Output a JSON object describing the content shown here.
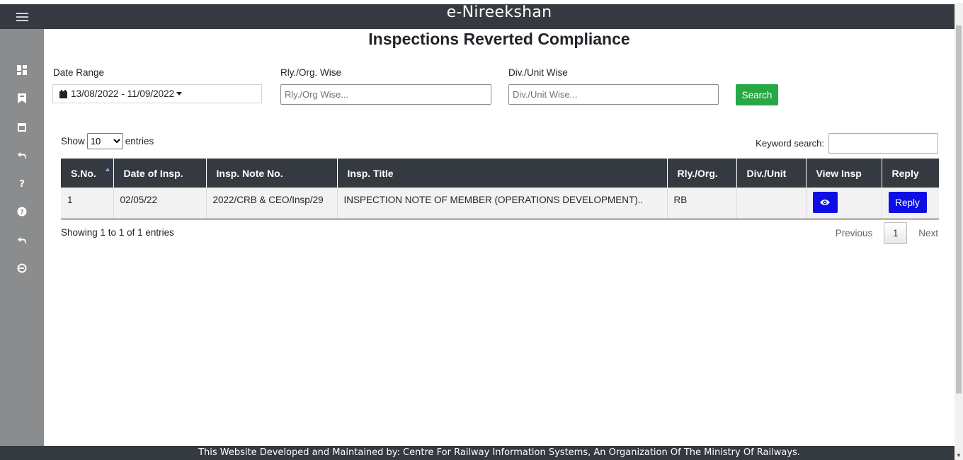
{
  "header": {
    "brand": "e-Nireekshan"
  },
  "sidebar": {
    "items": [
      {
        "icon": "dashboard-icon"
      },
      {
        "icon": "bookmark-icon"
      },
      {
        "icon": "calendar-icon"
      },
      {
        "icon": "reply-icon"
      },
      {
        "icon": "question-icon"
      },
      {
        "icon": "help-circle-icon"
      },
      {
        "icon": "reply-icon"
      },
      {
        "icon": "logout-icon"
      }
    ]
  },
  "page": {
    "title": "Inspections Reverted Compliance"
  },
  "filters": {
    "date_range_label": "Date Range",
    "date_range_value": "13/08/2022 - 11/09/2022",
    "rly_label": "Rly./Org. Wise",
    "rly_placeholder": "Rly./Org Wise...",
    "div_label": "Div./Unit Wise",
    "div_placeholder": "Div./Unit Wise...",
    "search_label": "Search"
  },
  "table_controls": {
    "show_label": "Show",
    "entries_value": "10",
    "entries_label": "entries",
    "keyword_label": "Keyword search:"
  },
  "table": {
    "headers": [
      "S.No.",
      "Date of Insp.",
      "Insp. Note No.",
      "Insp. Title",
      "Rly./Org.",
      "Div./Unit",
      "View Insp",
      "Reply"
    ],
    "rows": [
      {
        "sno": "1",
        "date": "02/05/22",
        "note_no": "2022/CRB & CEO/Insp/29",
        "title": "INSPECTION NOTE OF MEMBER (OPERATIONS DEVELOPMENT)..",
        "rly": "RB",
        "div": "",
        "reply_label": "Reply"
      }
    ]
  },
  "pagination": {
    "info": "Showing 1 to 1 of 1 entries",
    "previous": "Previous",
    "current": "1",
    "next": "Next"
  },
  "footer": {
    "text": "This Website Developed and Maintained by: Centre For Railway Information Systems, An Organization Of The Ministry Of Railways."
  },
  "colors": {
    "dark": "#343a40",
    "sidebar": "#8a8c8e",
    "success": "#28a745",
    "primary": "#0d0de6"
  }
}
